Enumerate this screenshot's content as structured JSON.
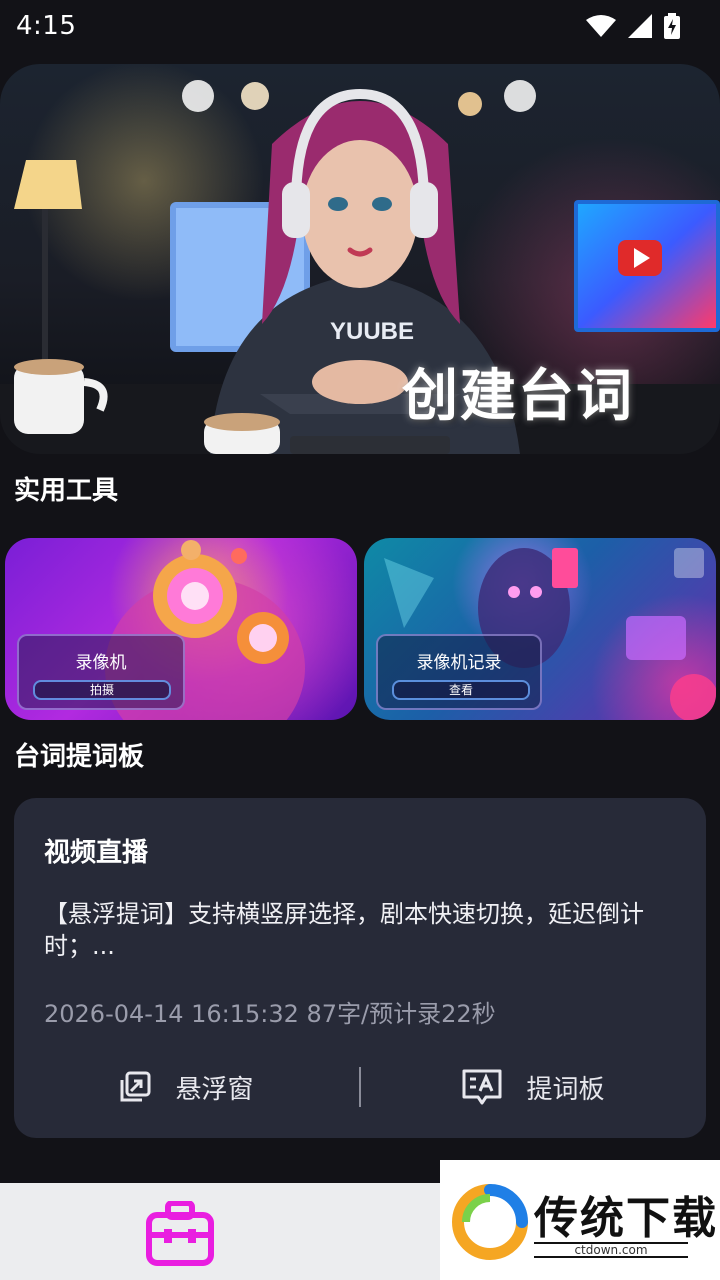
{
  "status": {
    "time": "4:15"
  },
  "hero": {
    "title": "创建台词",
    "shirt_text": "YUUBE"
  },
  "sections": {
    "tools_title": "实用工具",
    "board_title": "台词提词板"
  },
  "tools": [
    {
      "name": "录像机",
      "action": "拍摄"
    },
    {
      "name": "录像机记录",
      "action": "查看"
    }
  ],
  "script": {
    "title": "视频直播",
    "description": "【悬浮提词】支持横竖屏选择，剧本快速切换，延迟倒计时；...",
    "meta": "2026-04-14 16:15:32  87字/预计录22秒",
    "float_label": "悬浮窗",
    "board_label": "提词板"
  },
  "nav": {
    "active_icon": "toolbox-icon",
    "active_color": "#e91ee0"
  },
  "watermark": {
    "text": "传统下载",
    "sub": "ctdown.com"
  },
  "colors": {
    "background": "#121217",
    "card": "#272a38",
    "nav": "#ecedef"
  }
}
